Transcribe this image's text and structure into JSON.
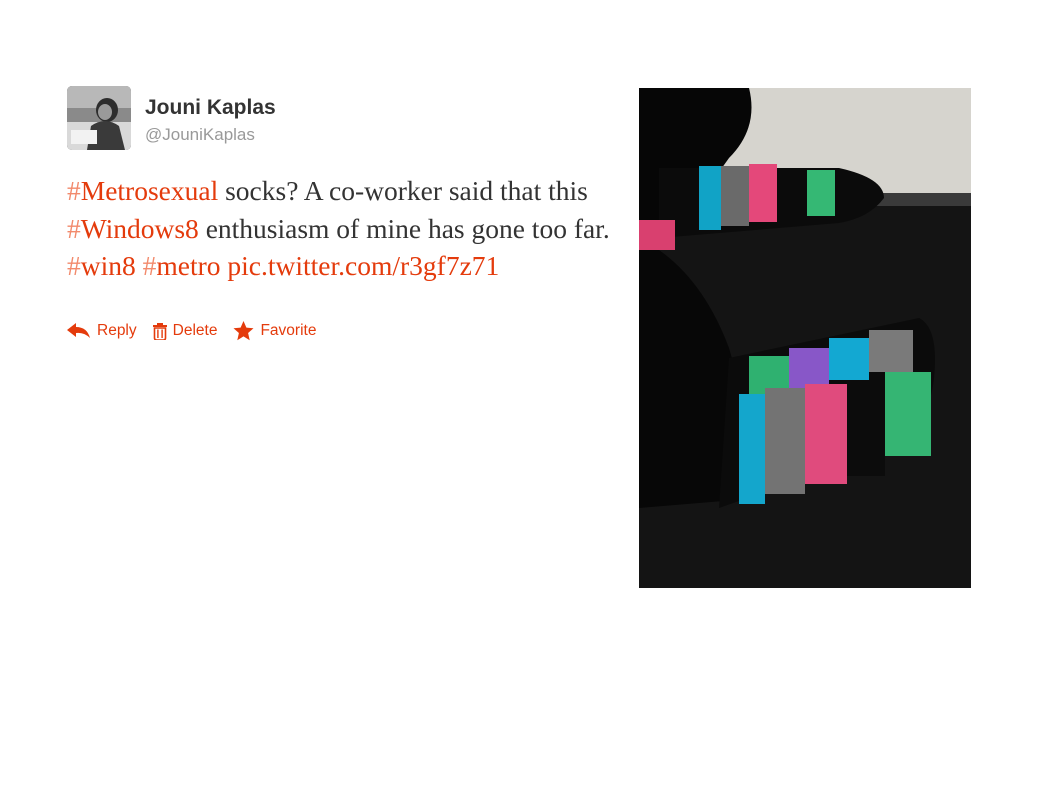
{
  "author": {
    "name": "Jouni Kaplas",
    "handle": "@JouniKaplas"
  },
  "tweet": {
    "t1_hash": "#",
    "t1_tag": "Metrosexual",
    "t2": " socks? A co-worker said that this ",
    "t3_hash": "#",
    "t3_tag": "Windows8",
    "t4": " enthusiasm of mine has gone too far. ",
    "t5_hash": "#",
    "t5_tag": "win8",
    "t6": " ",
    "t7_hash": "#",
    "t7_tag": "metro",
    "link": "pic.twitter.com/r3gf7z71"
  },
  "actions": {
    "reply": "Reply",
    "delete": "Delete",
    "favorite": "Favorite"
  },
  "colors": {
    "link": "#e43b0c",
    "text": "#333333",
    "muted": "#999999"
  },
  "icons": [
    "reply-icon",
    "trash-icon",
    "star-icon"
  ]
}
